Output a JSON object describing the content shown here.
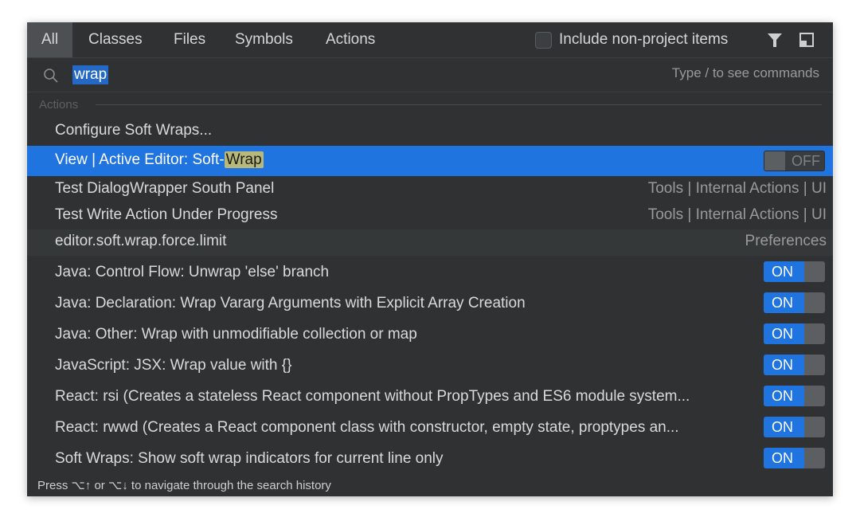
{
  "tabs": [
    "All",
    "Classes",
    "Files",
    "Symbols",
    "Actions"
  ],
  "include_label": "Include non-project items",
  "include_checked": false,
  "search": {
    "query": "wrap",
    "hint": "Type / to see commands"
  },
  "section": "Actions",
  "rows": [
    {
      "pre": "Configure Soft Wraps...",
      "hl": "",
      "right": ""
    },
    {
      "pre": "View | Active Editor: Soft-",
      "hl": "Wrap",
      "right": "",
      "toggle": "OFF"
    },
    {
      "pre": "Test DialogWrapper South Panel",
      "right": "Tools | Internal Actions | UI"
    },
    {
      "pre": "Test Write Action Under Progress",
      "right": "Tools | Internal Actions | UI"
    },
    {
      "pre": "editor.soft.wrap.force.limit",
      "right": "Preferences"
    },
    {
      "pre": "Java: Control Flow: Unwrap 'else' branch",
      "toggle": "ON"
    },
    {
      "pre": "Java: Declaration: Wrap Vararg Arguments with Explicit Array Creation",
      "toggle": "ON"
    },
    {
      "pre": "Java: Other: Wrap with unmodifiable collection or map",
      "toggle": "ON"
    },
    {
      "pre": "JavaScript: JSX: Wrap value with {}",
      "toggle": "ON"
    },
    {
      "pre": "React: rsi (Creates a stateless React component without PropTypes and ES6 module system...",
      "toggle": "ON"
    },
    {
      "pre": "React: rwwd (Creates a React component class with constructor, empty state, proptypes an...",
      "toggle": "ON"
    },
    {
      "pre": "Soft Wraps: Show soft wrap indicators for current line only",
      "toggle": "ON"
    }
  ],
  "footer": "Press ⌥↑ or ⌥↓ to navigate through the search history",
  "colors": {
    "accent": "#1f74e0",
    "highlight": "#b7b87a",
    "background": "#2f3132"
  }
}
